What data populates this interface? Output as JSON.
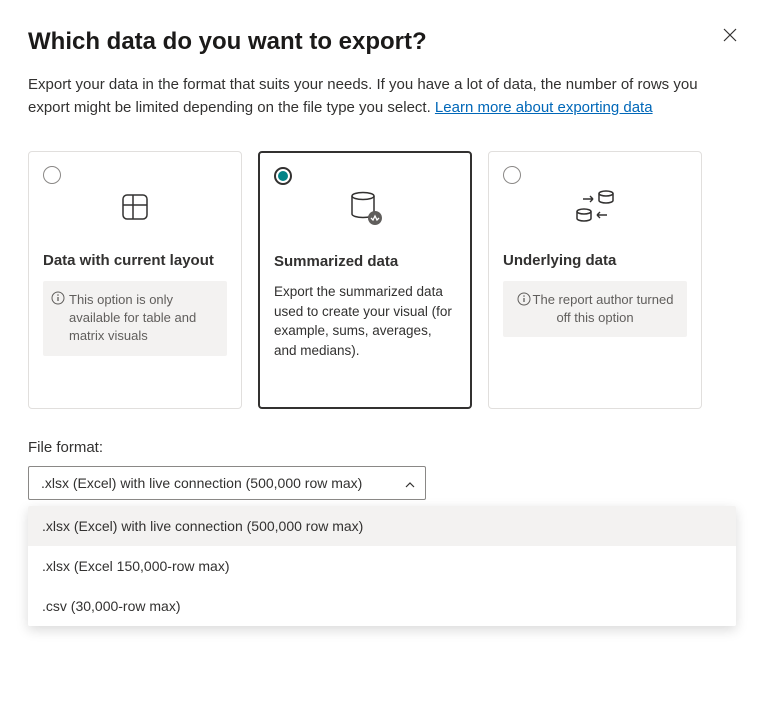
{
  "dialog": {
    "title": "Which data do you want to export?",
    "description": "Export your data in the format that suits your needs. If you have a lot of data, the number of rows you export might be limited depending on the file type you select.  ",
    "learnMoreText": "Learn more about exporting data"
  },
  "cards": [
    {
      "title": "Data with current layout",
      "note": "This option is only available for table and matrix visuals",
      "type": "note",
      "selected": false
    },
    {
      "title": "Summarized data",
      "desc": "Export the summarized data used to create your visual (for example, sums, averages, and medians).",
      "type": "desc",
      "selected": true
    },
    {
      "title": "Underlying data",
      "note": "The report author turned off this option",
      "type": "note-centered",
      "selected": false
    }
  ],
  "fileFormat": {
    "label": "File format:",
    "selected": ".xlsx (Excel) with live connection (500,000 row max)",
    "options": [
      ".xlsx (Excel) with live connection (500,000 row max)",
      ".xlsx (Excel 150,000-row max)",
      ".csv (30,000-row max)"
    ]
  }
}
